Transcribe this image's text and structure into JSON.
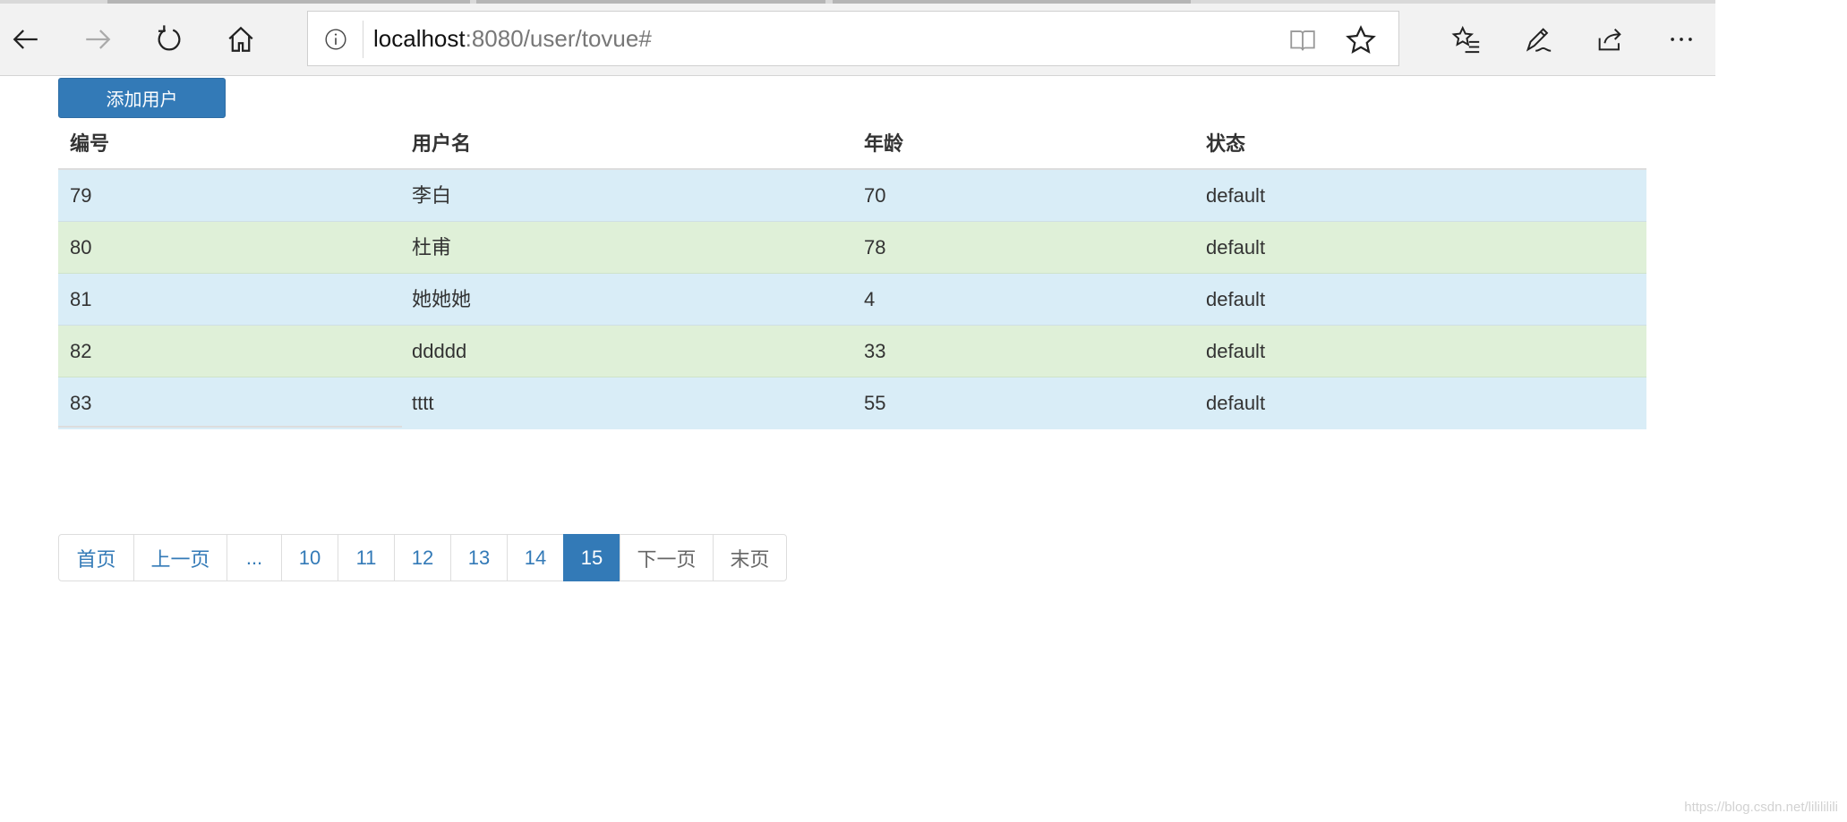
{
  "browser": {
    "url_host": "localhost",
    "url_rest": ":8080/user/tovue#"
  },
  "page": {
    "add_button_label": "添加用户"
  },
  "table": {
    "headers": [
      "编号",
      "用户名",
      "年龄",
      "状态"
    ],
    "rows": [
      {
        "id": "79",
        "username": "李白",
        "age": "70",
        "status": "default"
      },
      {
        "id": "80",
        "username": "杜甫",
        "age": "78",
        "status": "default"
      },
      {
        "id": "81",
        "username": "她她她",
        "age": "4",
        "status": "default"
      },
      {
        "id": "82",
        "username": "ddddd",
        "age": "33",
        "status": "default"
      },
      {
        "id": "83",
        "username": "tttt",
        "age": "55",
        "status": "default"
      }
    ]
  },
  "pagination": {
    "first": "首页",
    "prev": "上一页",
    "ellipsis": "...",
    "pages": [
      "10",
      "11",
      "12",
      "13",
      "14",
      "15"
    ],
    "current": "15",
    "next": "下一页",
    "last": "末页"
  },
  "watermark": "https://blog.csdn.net/lilililili",
  "colors": {
    "primary": "#337ab7",
    "row_info": "#d9edf7",
    "row_success": "#dff0d8"
  }
}
